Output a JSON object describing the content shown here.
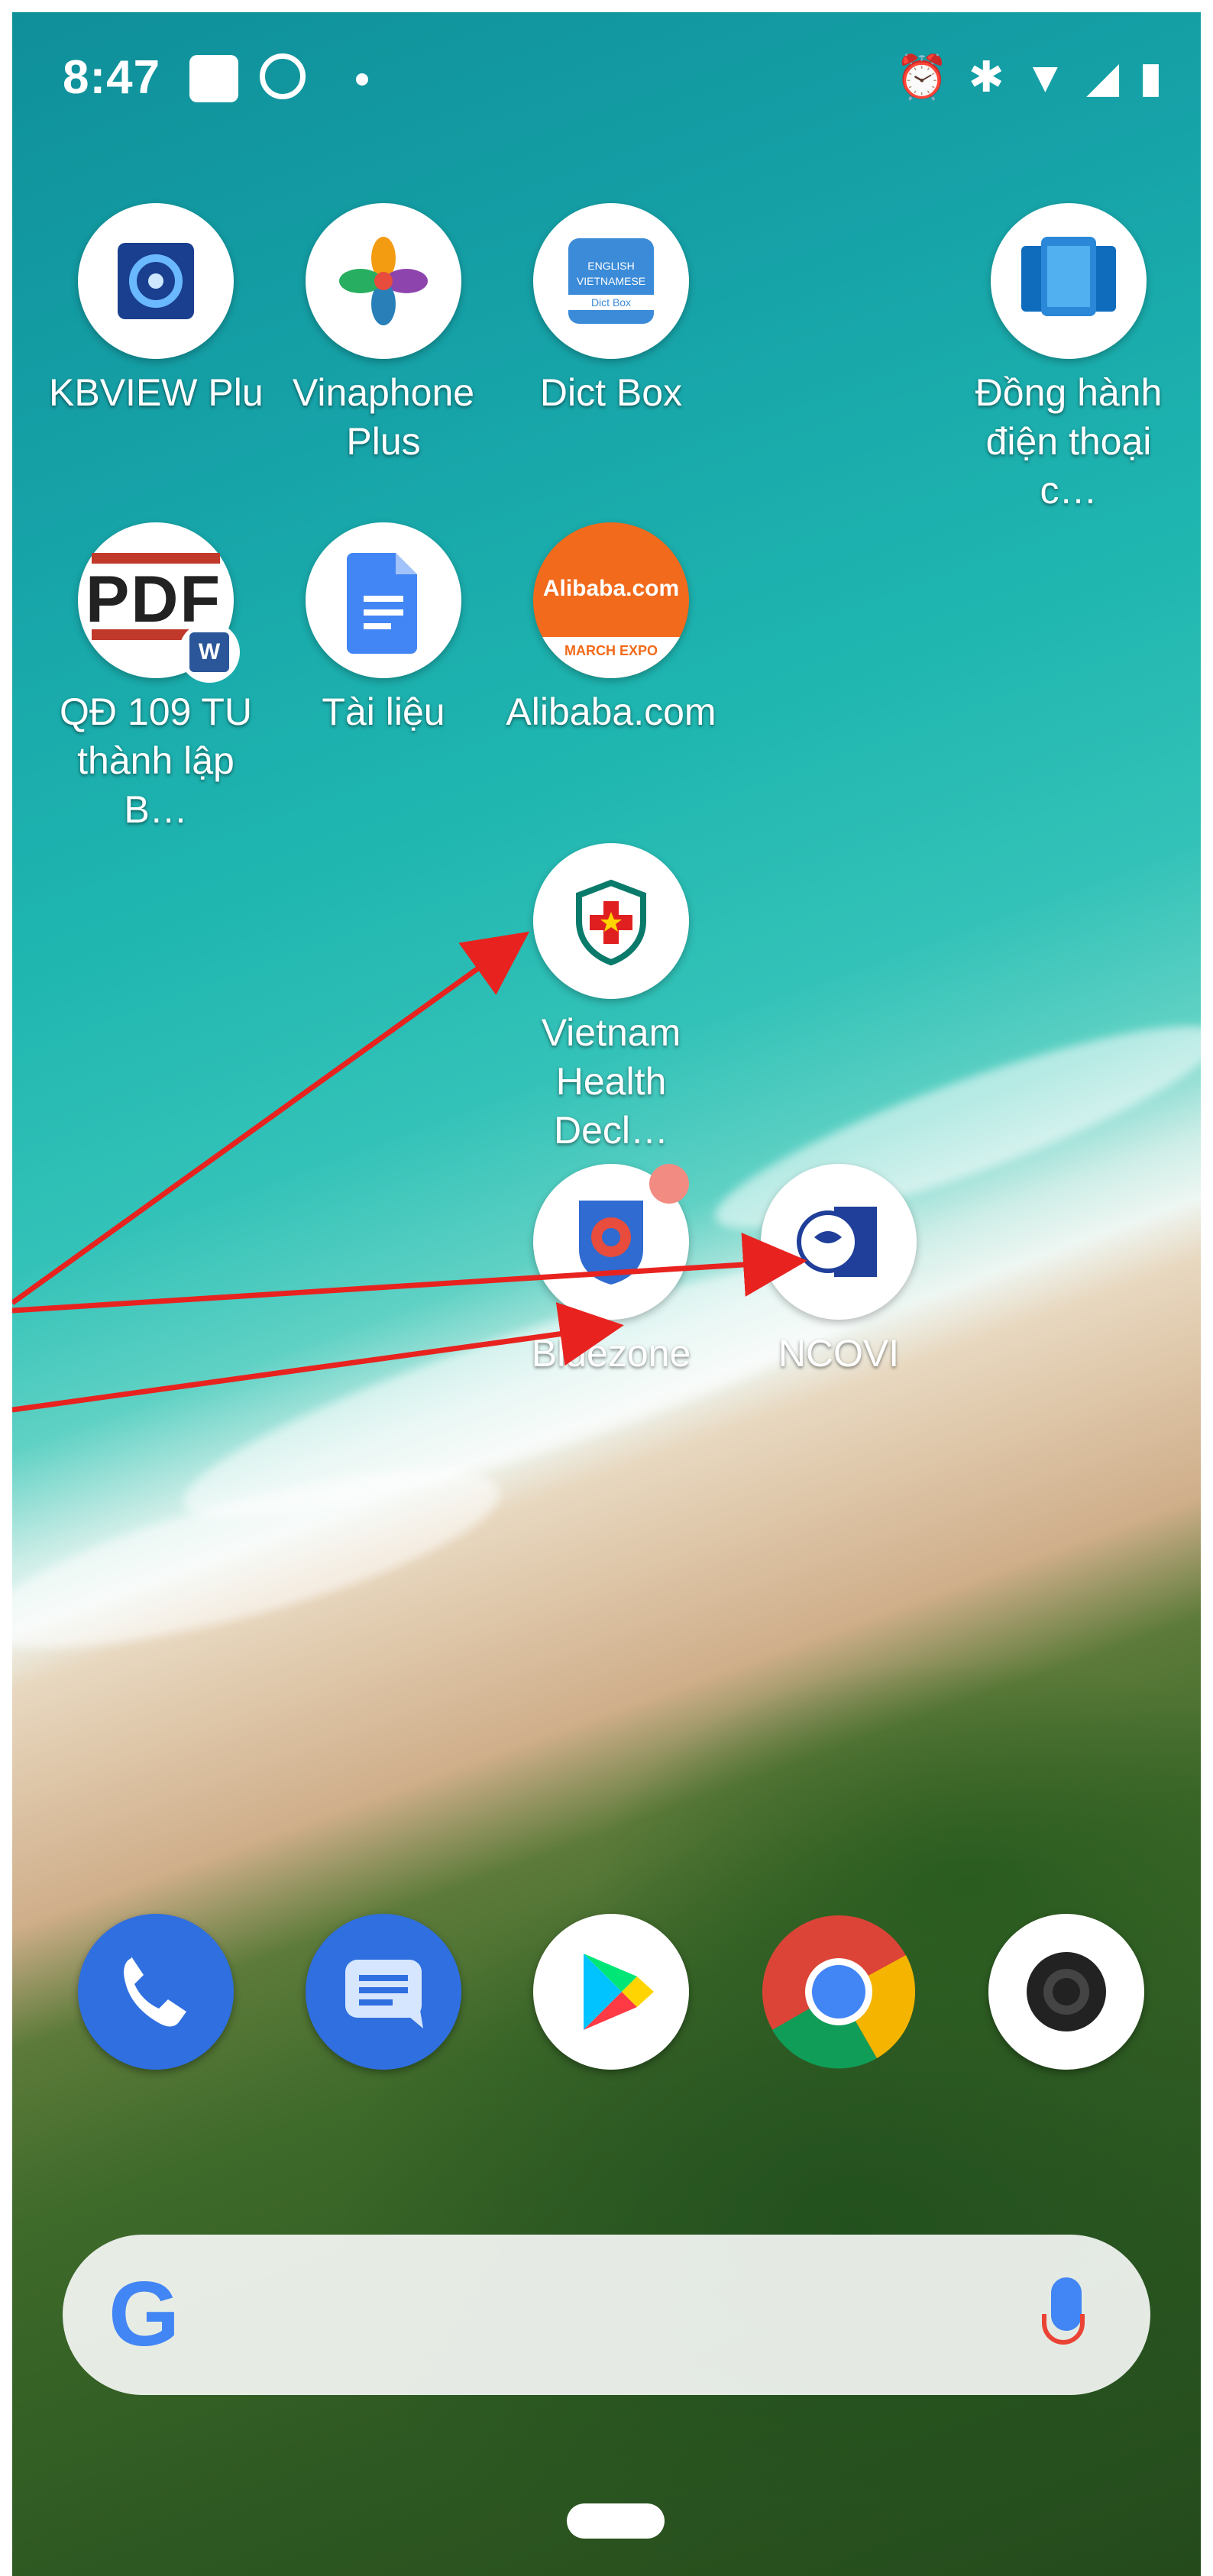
{
  "status_bar": {
    "time": "8:47",
    "icons": [
      "square-notification-icon",
      "clock-rotate-icon",
      "dot-icon",
      "alarm-icon",
      "bluetooth-icon",
      "wifi-icon",
      "signal-icon",
      "battery-icon"
    ]
  },
  "home_apps": [
    {
      "name": "KBVIEW Plus",
      "label": "KBVIEW Plus"
    },
    {
      "name": "Vinaphone Plus",
      "label": "Vinaphone Plus"
    },
    {
      "name": "Dict Box",
      "label": "Dict Box",
      "icon_text": [
        "ENGLISH",
        "VIETNAMESE",
        "Dict Box"
      ]
    },
    {
      "name": "Dong hanh dien thoai",
      "label": "Đồng hành điện thoại c…"
    },
    {
      "name": "QD 109 TU",
      "label": "QĐ 109 TU thành lập B…",
      "icon_text": "PDF"
    },
    {
      "name": "Tai lieu",
      "label": "Tài liệu"
    },
    {
      "name": "Alibaba.com",
      "label": "Alibaba.com",
      "icon_text": [
        "Alibaba.com",
        "MARCH EXPO"
      ]
    },
    {
      "name": "Vietnam Health Declaration",
      "label": "Vietnam Health Decl…"
    },
    {
      "name": "Bluezone",
      "label": "Bluezone"
    },
    {
      "name": "NCOVI",
      "label": "NCOVI"
    }
  ],
  "dock": [
    {
      "name": "Phone"
    },
    {
      "name": "Messages"
    },
    {
      "name": "Play Store"
    },
    {
      "name": "Chrome"
    },
    {
      "name": "Camera"
    }
  ],
  "search_bar": {
    "logo": "G"
  },
  "colors": {
    "annotation_arrow": "#e8231f",
    "google_blue": "#4285f4",
    "alibaba_orange": "#f26a1b",
    "notification_dot": "#f28b82"
  }
}
